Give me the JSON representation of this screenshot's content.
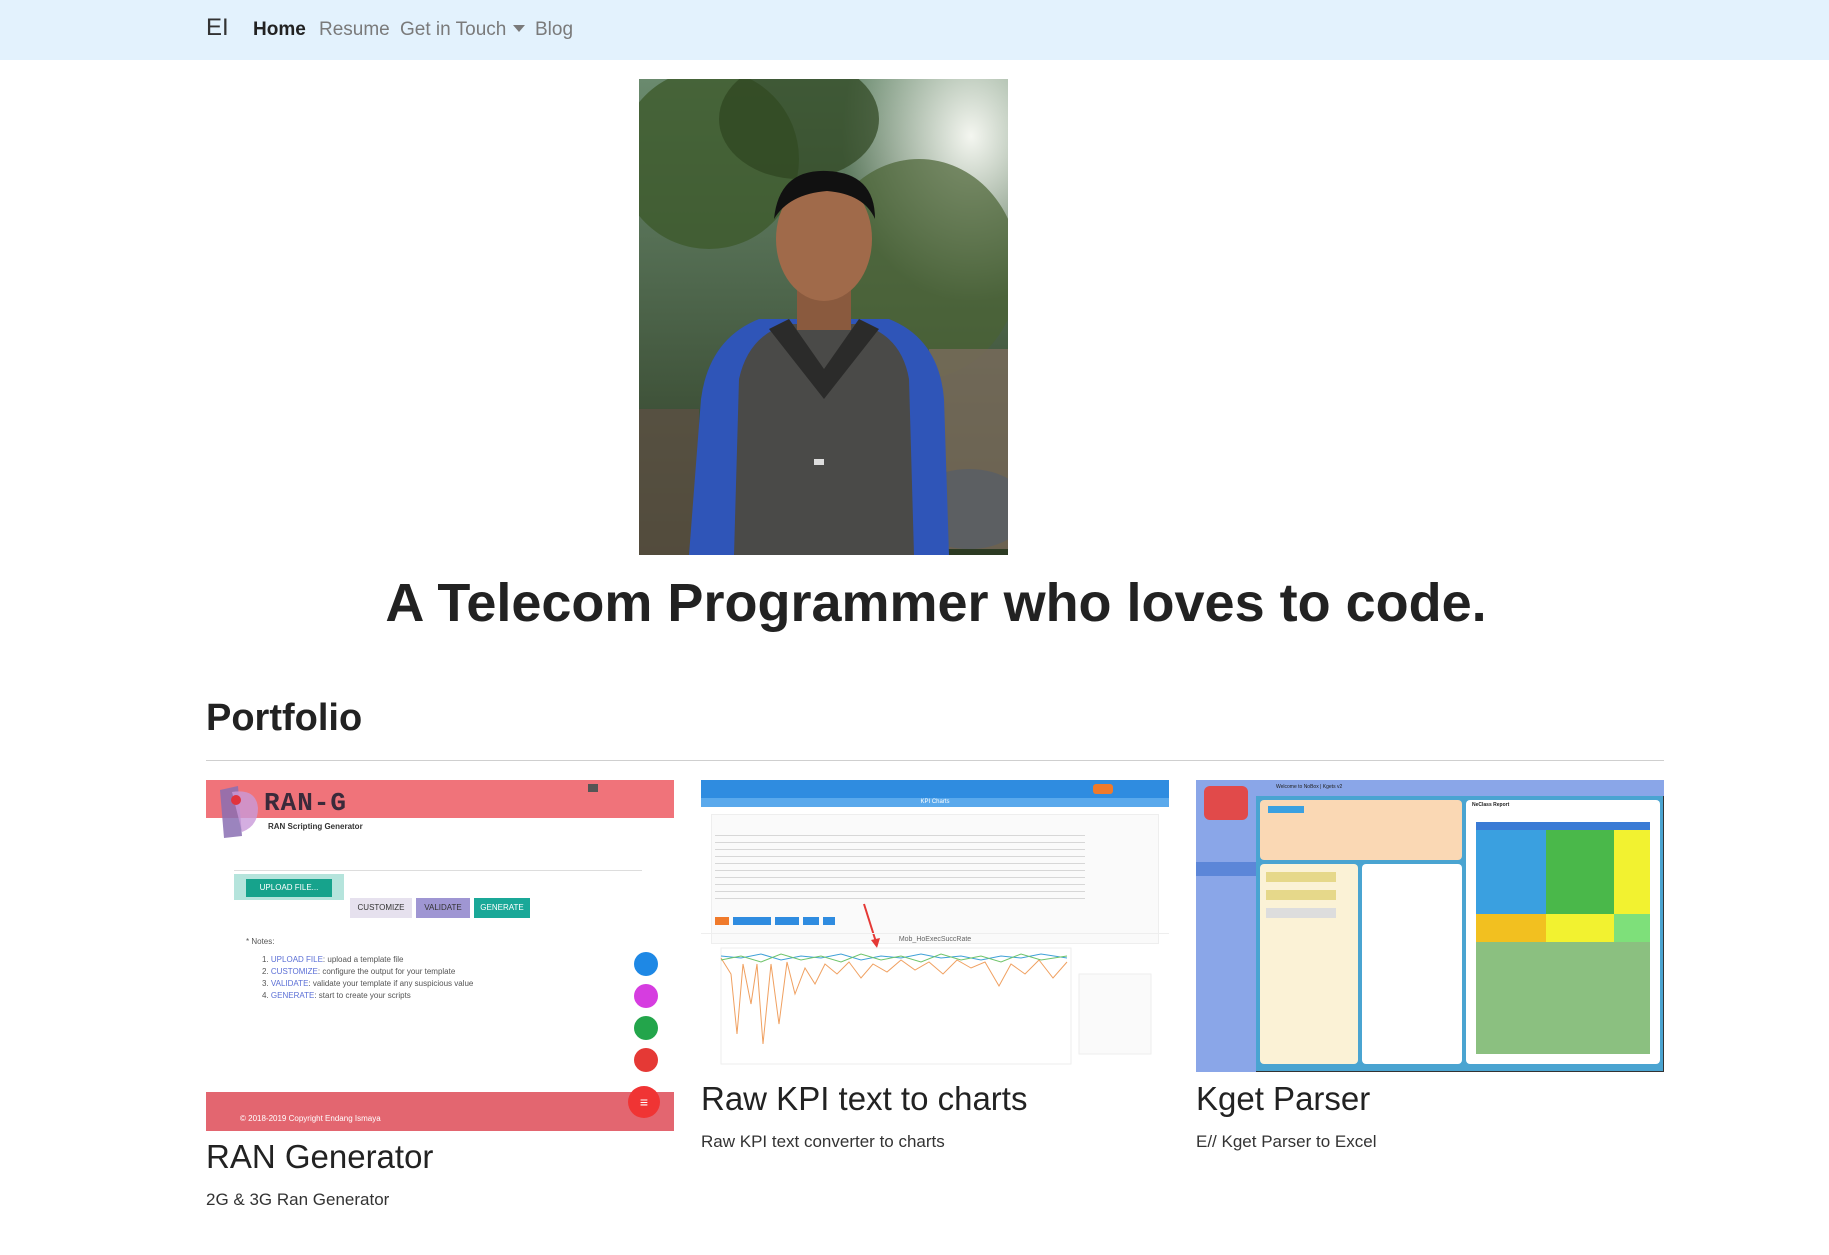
{
  "navbar": {
    "brand": "EI",
    "links": [
      {
        "label": "Home",
        "active": true
      },
      {
        "label": "Resume"
      },
      {
        "label": "Get in Touch",
        "dropdown": true
      },
      {
        "label": "Blog"
      }
    ]
  },
  "hero": {
    "tagline": "A Telecom Programmer who loves to code."
  },
  "portfolio": {
    "title": "Portfolio",
    "items": [
      {
        "title": "RAN Generator",
        "description": "2G & 3G Ran Generator",
        "thumb": {
          "app_title": "RAN-G",
          "app_subtitle": "RAN Scripting Generator",
          "upload_label": "UPLOAD FILE...",
          "buttons": [
            "CUSTOMIZE",
            "VALIDATE",
            "GENERATE"
          ],
          "notes_title": "* Notes:",
          "notes": [
            {
              "key": "UPLOAD FILE",
              "text": ": upload a template file"
            },
            {
              "key": "CUSTOMIZE",
              "text": ": configure the output for your template"
            },
            {
              "key": "VALIDATE",
              "text": ": validate your template if any suspicious value"
            },
            {
              "key": "GENERATE",
              "text": ": start to create your scripts"
            }
          ],
          "footer": "© 2018-2019 Copyright Endang Ismaya"
        }
      },
      {
        "title": "Raw KPI text to charts",
        "description": "Raw KPI text converter to charts",
        "thumb": {
          "header": "KPI Charts",
          "chart_title": "Mob_HoExecSuccRate"
        }
      },
      {
        "title": "Kget Parser",
        "description": "E// Kget Parser to Excel",
        "thumb": {
          "window_title": "Welcome to NoBox | Kgets v2",
          "report_title": "NeClass Report"
        }
      }
    ]
  },
  "colors": {
    "navbar_bg": "#e3f2fd",
    "rang_header": "#f0737a",
    "kpi_header": "#2f8ce0",
    "kget_bg": "#4aa4d1"
  }
}
